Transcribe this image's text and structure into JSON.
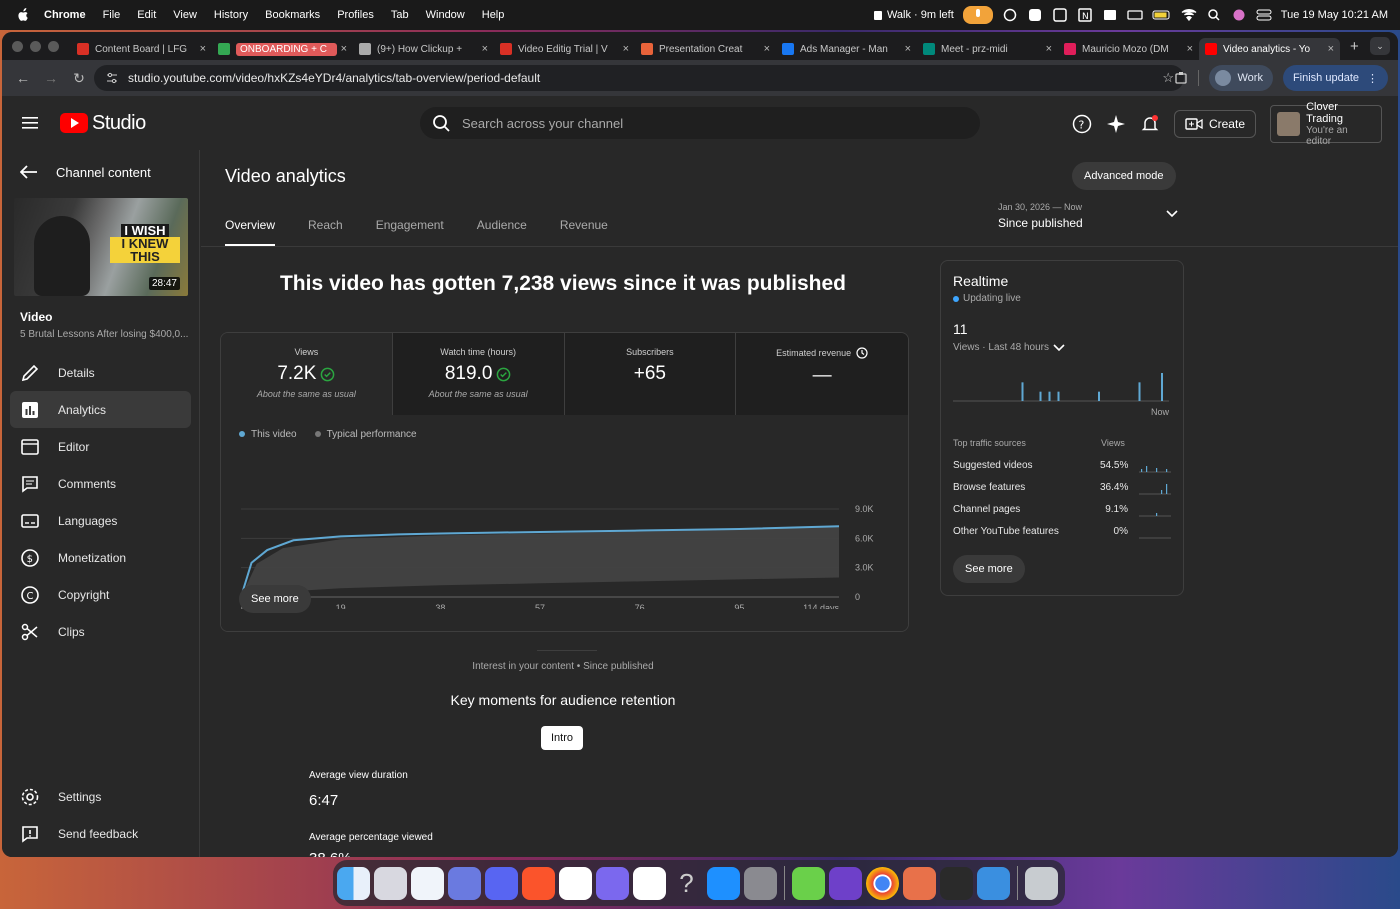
{
  "menubar": {
    "app": "Chrome",
    "items": [
      "File",
      "Edit",
      "View",
      "History",
      "Bookmarks",
      "Profiles",
      "Tab",
      "Window",
      "Help"
    ],
    "walk": "Walk · 9m left",
    "datetime": "Tue 19 May  10:21 AM"
  },
  "browser": {
    "tabs": [
      {
        "label": "Content Board | LFG",
        "color": "#d93025"
      },
      {
        "label": "ONBOARDING + C",
        "color": "#34a853"
      },
      {
        "label": "(9+) How Clickup +",
        "color": "#aaaaaa"
      },
      {
        "label": "Video Editig Trial | V",
        "color": "#d93025"
      },
      {
        "label": "Presentation Creat",
        "color": "#e8633a"
      },
      {
        "label": "Ads Manager - Man",
        "color": "#1877f2"
      },
      {
        "label": "Meet - prz-midi",
        "color": "#00897b"
      },
      {
        "label": "Mauricio Mozo (DM",
        "color": "#e01e5a"
      },
      {
        "label": "Video analytics - Yo",
        "color": "#ff0000"
      }
    ],
    "url": "studio.youtube.com/video/hxKZs4eYDr4/analytics/tab-overview/period-default",
    "profile": "Work",
    "update": "Finish update"
  },
  "studio": {
    "logo": "Studio",
    "search_placeholder": "Search across your channel",
    "create": "Create",
    "account_name": "Clover Trading",
    "account_role": "You're an editor"
  },
  "sidebar": {
    "back_label": "Channel content",
    "thumb_line1": "I WISH",
    "thumb_line2": "I KNEW THIS",
    "duration": "28:47",
    "video_label": "Video",
    "video_title": "5 Brutal Lessons After losing $400,0...",
    "items": [
      "Details",
      "Analytics",
      "Editor",
      "Comments",
      "Languages",
      "Monetization",
      "Copyright",
      "Clips"
    ],
    "bottom": [
      "Settings",
      "Send feedback"
    ]
  },
  "main": {
    "title": "Video analytics",
    "advanced": "Advanced mode",
    "date_range": "Jan 30, 2026 — Now",
    "period": "Since published",
    "tabs": [
      "Overview",
      "Reach",
      "Engagement",
      "Audience",
      "Revenue"
    ],
    "headline": "This video has gotten 7,238 views since it was published",
    "stats": [
      {
        "label": "Views",
        "value": "7.2K",
        "caption": "About the same as usual"
      },
      {
        "label": "Watch time (hours)",
        "value": "819.0",
        "caption": "About the same as usual"
      },
      {
        "label": "Subscribers",
        "value": "+65",
        "caption": ""
      },
      {
        "label": "Estimated revenue",
        "value": "—",
        "caption": ""
      }
    ],
    "legend": [
      "This video",
      "Typical performance"
    ],
    "see_more": "See more",
    "interest": "Interest in your content • Since published",
    "key_moments": "Key moments for audience retention",
    "intro": "Intro",
    "avd_label": "Average view duration",
    "avd_value": "6:47",
    "apv_label": "Average percentage viewed",
    "apv_value": "38.6%"
  },
  "chart_data": {
    "type": "line",
    "x_ticks": [
      "0",
      "19",
      "38",
      "57",
      "76",
      "95",
      "114 days"
    ],
    "y_ticks": [
      "9.0K",
      "6.0K",
      "3.0K",
      "0"
    ],
    "ylim": [
      0,
      9000
    ],
    "series": [
      {
        "name": "This video",
        "x": [
          0,
          2,
          5,
          10,
          19,
          30,
          38,
          57,
          76,
          95,
          114
        ],
        "y": [
          0,
          3500,
          4800,
          5800,
          6200,
          6400,
          6500,
          6650,
          6800,
          6950,
          7238
        ]
      }
    ],
    "band_upper": {
      "x": [
        0,
        3,
        8,
        19,
        38,
        57,
        76,
        95,
        114
      ],
      "y": [
        0,
        3400,
        5000,
        5900,
        6300,
        6500,
        6700,
        6900,
        7300
      ]
    },
    "band_lower": {
      "x": [
        0,
        5,
        10,
        19,
        38,
        57,
        76,
        95,
        114
      ],
      "y": [
        0,
        300,
        600,
        900,
        1200,
        1400,
        1600,
        1800,
        2000
      ]
    },
    "colors": {
      "line": "#5fa8d3",
      "band": "#444444"
    }
  },
  "realtime": {
    "title": "Realtime",
    "live": "Updating live",
    "value": "11",
    "subtitle": "Views · Last 48 hours",
    "now": "Now",
    "bars": [
      0,
      0,
      0,
      0,
      0,
      0,
      0,
      0,
      0,
      0,
      0,
      0,
      0,
      0,
      0,
      4,
      0,
      0,
      0,
      2,
      0,
      2,
      0,
      2,
      0,
      0,
      0,
      0,
      0,
      0,
      0,
      0,
      2,
      0,
      0,
      0,
      0,
      0,
      0,
      0,
      0,
      4,
      0,
      0,
      0,
      0,
      6,
      0
    ],
    "traffic_header": "Top traffic sources",
    "views_header": "Views",
    "sources": [
      {
        "name": "Suggested videos",
        "pct": "54.5%"
      },
      {
        "name": "Browse features",
        "pct": "36.4%"
      },
      {
        "name": "Channel pages",
        "pct": "9.1%"
      },
      {
        "name": "Other YouTube features",
        "pct": "0%"
      }
    ],
    "see_more": "See more"
  }
}
